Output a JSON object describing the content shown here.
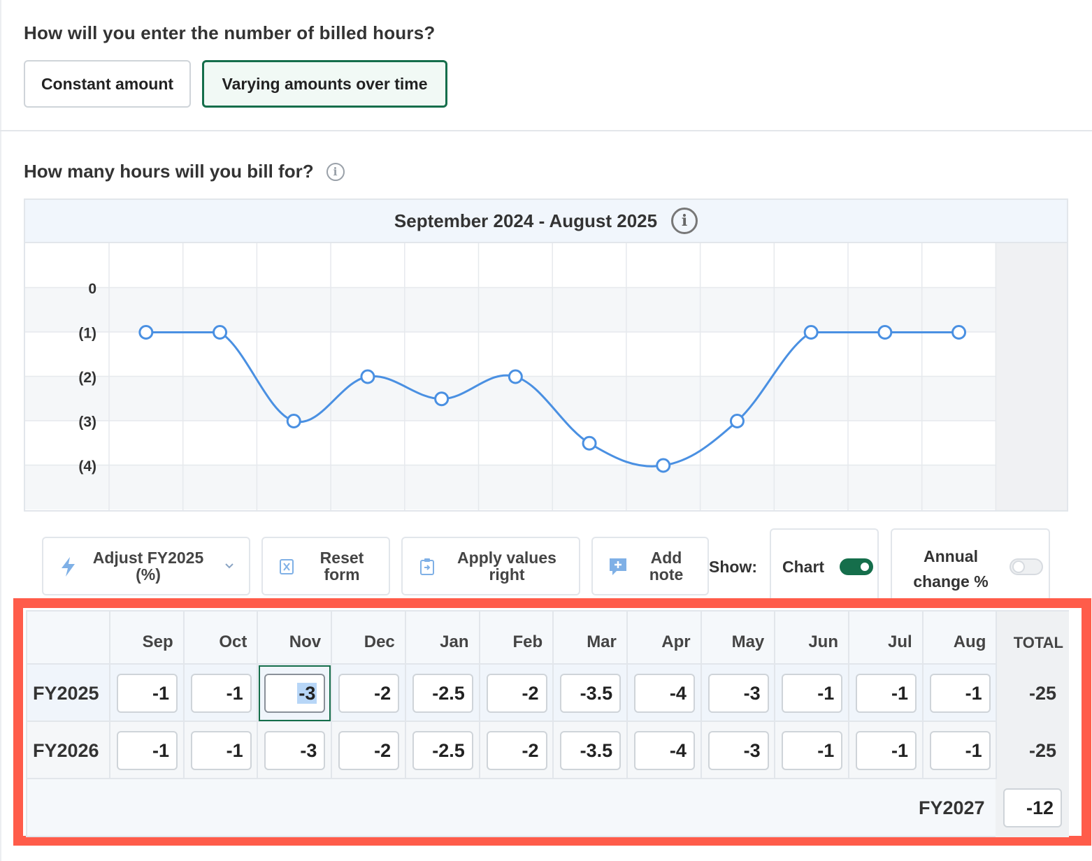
{
  "question1": "How will you enter the number of billed hours?",
  "options": [
    "Constant amount",
    "Varying amounts over time"
  ],
  "question2": "How many hours will you bill for?",
  "chart": {
    "title": "September 2024 - August 2025",
    "info_icon": "info-icon"
  },
  "chart_data": {
    "type": "line",
    "title": "September 2024 - August 2025",
    "categories": [
      "Sep",
      "Oct",
      "Nov",
      "Dec",
      "Jan",
      "Feb",
      "Mar",
      "Apr",
      "May",
      "Jun",
      "Jul",
      "Aug"
    ],
    "series": [
      {
        "values": [
          -1,
          -1,
          -3,
          -2,
          -2.5,
          -2,
          -3.5,
          -4,
          -3,
          -1,
          -1,
          -1
        ]
      }
    ],
    "yticks": [
      "0",
      "(1)",
      "(2)",
      "(3)",
      "(4)"
    ],
    "ylim": [
      -5,
      1
    ],
    "line_color": "#4a90e2"
  },
  "toolbar": {
    "adjust": "Adjust FY2025 (%)",
    "reset": "Reset form",
    "apply": "Apply values right",
    "note": "Add note",
    "show_label": "Show:",
    "chart_toggle": "Chart",
    "chart_on": true,
    "annual_toggle": "Annual change %",
    "annual_on": false,
    "accent": "#156e4b"
  },
  "table": {
    "months": [
      "Sep",
      "Oct",
      "Nov",
      "Dec",
      "Jan",
      "Feb",
      "Mar",
      "Apr",
      "May",
      "Jun",
      "Jul",
      "Aug"
    ],
    "total_header": "TOTAL",
    "rows": [
      {
        "label": "FY2025",
        "values": [
          "-1",
          "-1",
          "-3",
          "-2",
          "-2.5",
          "-2",
          "-3.5",
          "-4",
          "-3",
          "-1",
          "-1",
          "-1"
        ],
        "total": "-25"
      },
      {
        "label": "FY2026",
        "values": [
          "-1",
          "-1",
          "-3",
          "-2",
          "-2.5",
          "-2",
          "-3.5",
          "-4",
          "-3",
          "-1",
          "-1",
          "-1"
        ],
        "total": "-25"
      }
    ],
    "fy2027_label": "FY2027",
    "fy2027_value": "-12"
  }
}
